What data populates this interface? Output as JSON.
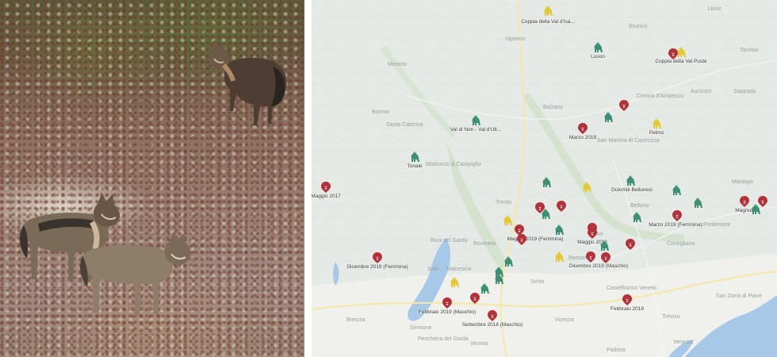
{
  "colors": {
    "wolf_pack": "#3f8f77",
    "couple": "#e3c93a",
    "dead_wolf": "#b5313a"
  },
  "photo": {
    "wolves": [
      {
        "name": "wolf-standing-back",
        "icon": "wolf-photo"
      },
      {
        "name": "wolf-front-left",
        "icon": "wolf-photo"
      },
      {
        "name": "wolf-front-right",
        "icon": "wolf-photo"
      }
    ]
  },
  "map": {
    "places": [
      "Merano",
      "Bolzano",
      "Brunico",
      "Cortina d'Ampezzo",
      "Trento",
      "Rovereto",
      "Schio",
      "Vicenza",
      "Verona",
      "Padova",
      "Treviso",
      "Venezia",
      "Conegliano",
      "Pordenone",
      "Belluno",
      "Feltre",
      "Bassano",
      "Castelfranco Veneto",
      "Brescia",
      "Bormio",
      "Peschiera del Garda",
      "Sirmione",
      "Malcesine",
      "Riva del Garda",
      "Lienz",
      "Tarvisio",
      "Sappada",
      "Auronzo",
      "Vipiteno",
      "San Martino di Castrozza",
      "Santa Caterina",
      "Madonna di Campiglio",
      "Salò",
      "San Donà di Piave",
      "Maniago"
    ],
    "labels": {
      "coppia_val_disarco": "Coppia della Val d'Isa...",
      "luson": "Luson",
      "coppia_val_pusteria": "Coppia della Val Puste",
      "val_di_non": "Val di Non - Val d'Ult...",
      "marzo_2019": "Marzo 2019",
      "pelmo": "Pelmo",
      "tonale": "Tonale",
      "maggio_2017": "Maggio 2017",
      "dolomiti_bellunesi": "Dolomiti Bellunesi",
      "marzo_2019_femmina": "Marzo 2019 (Femmina)",
      "magredi": "Magredi",
      "maggio_2019_femmina": "Maggio 2019 (Femmina)",
      "maggio_2019": "Maggio 2019",
      "dicembre_2019_femmina": "Dicembre 2019 (Femmina)",
      "dicembre_2019_maschio": "Dicembre 2019 (Maschio)",
      "febbraio_2019_maschio": "Febbraio 2019 (Maschio)",
      "settembre_2018_maschio": "Settembre 2018 (Maschio)",
      "febbraio_2019": "Febbraio 2019"
    },
    "markers": [
      {
        "type": "couple",
        "label": "coppia_val_disarco"
      },
      {
        "type": "pack",
        "label": "luson"
      },
      {
        "type": "couple",
        "label": "coppia_val_pusteria"
      },
      {
        "type": "dead",
        "label": ""
      },
      {
        "type": "pack",
        "label": "val_di_non"
      },
      {
        "type": "dead",
        "label": ""
      },
      {
        "type": "pack",
        "label": ""
      },
      {
        "type": "dead",
        "label": "marzo_2019"
      },
      {
        "type": "couple",
        "label": "pelmo"
      },
      {
        "type": "pack",
        "label": "tonale"
      },
      {
        "type": "dead",
        "label": "maggio_2017"
      },
      {
        "type": "pack",
        "label": "dolomiti_bellunesi"
      },
      {
        "type": "pack",
        "label": ""
      },
      {
        "type": "couple",
        "label": ""
      },
      {
        "type": "pack",
        "label": ""
      },
      {
        "type": "pack",
        "label": ""
      },
      {
        "type": "dead",
        "label": ""
      },
      {
        "type": "dead",
        "label": ""
      },
      {
        "type": "pack",
        "label": ""
      },
      {
        "type": "dead",
        "label": "magredi"
      },
      {
        "type": "dead",
        "label": ""
      },
      {
        "type": "pack",
        "label": ""
      },
      {
        "type": "dead",
        "label": "marzo_2019_femmina"
      },
      {
        "type": "pack",
        "label": ""
      },
      {
        "type": "couple",
        "label": ""
      },
      {
        "type": "dead",
        "label": "maggio_2019_femmina"
      },
      {
        "type": "dead",
        "label": ""
      },
      {
        "type": "pack",
        "label": ""
      },
      {
        "type": "dead",
        "label": ""
      },
      {
        "type": "dead",
        "label": "maggio_2019"
      },
      {
        "type": "pack",
        "label": ""
      },
      {
        "type": "dead",
        "label": ""
      },
      {
        "type": "pack",
        "label": ""
      },
      {
        "type": "couple",
        "label": ""
      },
      {
        "type": "dead",
        "label": "dicembre_2019_maschio"
      },
      {
        "type": "dead",
        "label": ""
      },
      {
        "type": "dead",
        "label": "dicembre_2019_femmina"
      },
      {
        "type": "pack",
        "label": ""
      },
      {
        "type": "pack",
        "label": ""
      },
      {
        "type": "pack",
        "label": ""
      },
      {
        "type": "couple",
        "label": ""
      },
      {
        "type": "dead",
        "label": "febbraio_2019_maschio"
      },
      {
        "type": "dead",
        "label": ""
      },
      {
        "type": "dead",
        "label": "settembre_2018_maschio"
      },
      {
        "type": "dead",
        "label": "febbraio_2019"
      }
    ]
  }
}
